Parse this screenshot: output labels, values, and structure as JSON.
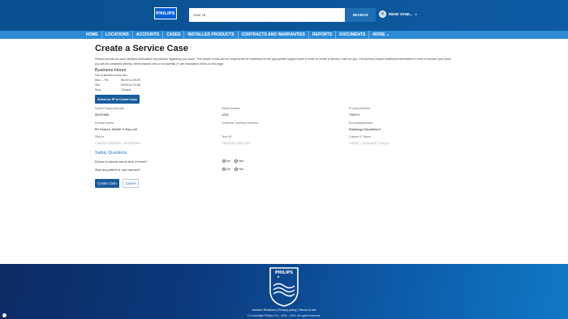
{
  "header": {
    "logo_text": "PHILIPS",
    "search": {
      "value": "case Ut",
      "button_label": "SEARCH"
    },
    "user": {
      "name": "RENE VANE..."
    }
  },
  "nav": {
    "items": [
      "HOME",
      "LOCATIONS",
      "ACCOUNTS",
      "CASES",
      "INSTALLED PRODUCTS",
      "CONTRACTS AND WARRANTIES",
      "REPORTS",
      "DOCUMENTS",
      "MORE ⌄"
    ]
  },
  "page": {
    "title": "Create a Service Case",
    "intro_line1": "Please provide as much detailed information as possible regarding your issue. The details of this service request will be forwarded to the appropriate support team in order to create a Service Case for you. Should they require additional information in order to resolve your issue,",
    "intro_line2": "you will be contacted directly. Items marked with a red asterisk (*) are mandatory fields on this page."
  },
  "business_hours": {
    "title": "Business Hours",
    "subtitle": "Our business hours are:",
    "rows": [
      {
        "day": "Mon – Fri:",
        "hours": "08:00 to 20:00"
      },
      {
        "day": "Sat:",
        "hours": "09:00 to 21:00"
      },
      {
        "day": "Sun:",
        "hours": "Closed"
      }
    ],
    "select_ip_button": "Select an IP to Create Case"
  },
  "fields": {
    "install_product_number": {
      "label": "Install Product Number",
      "value": "50202569"
    },
    "serial_number": {
      "label": "Serial Number",
      "value": "1252"
    },
    "product_number": {
      "label": "Product Number",
      "value": "718074"
    },
    "product_name": {
      "label": "Product Name",
      "value": "BV Endura, Mobile X-Ray unit"
    },
    "customer_inventory_number": {
      "label": "Customer Inventory Number",
      "value": ""
    },
    "room_department": {
      "label": "Room/Department",
      "value": "Radiology Department"
    },
    "ship_to": {
      "label": "Ship to",
      "value": "LIBESS BEMBEL HYPBHAR"
    },
    "tech_id": {
      "label": "Tech ID",
      "value": "1801000-30M-MS"
    },
    "custom_ip_name": {
      "label": "Custom IP Name",
      "value": "LIB4H - Deklabilt Thepoe"
    }
  },
  "safety": {
    "title": "Safety Questions",
    "questions": [
      {
        "text": "Device in clinical use at time of event?",
        "options": [
          "No",
          "Yes"
        ]
      },
      {
        "text": "Was any patient or user harmed?",
        "options": [
          "No",
          "Yes"
        ]
      }
    ]
  },
  "actions": {
    "create": "Create Case",
    "cancel": "Cancel"
  },
  "footer": {
    "links": "Investor Relations | Privacy policy | Terms of use",
    "copyright": "© Koninklijke Philips N.V., 2004 - 2019. All rights reserved.",
    "shield_text": "PHILIPS"
  },
  "colors": {
    "header_bg": "#0b5394",
    "nav_bg": "#2d8bd6",
    "primary_button": "#1a5d9c",
    "accent_text": "#1f7ac8",
    "footer_bg": "#0c3a7e"
  }
}
